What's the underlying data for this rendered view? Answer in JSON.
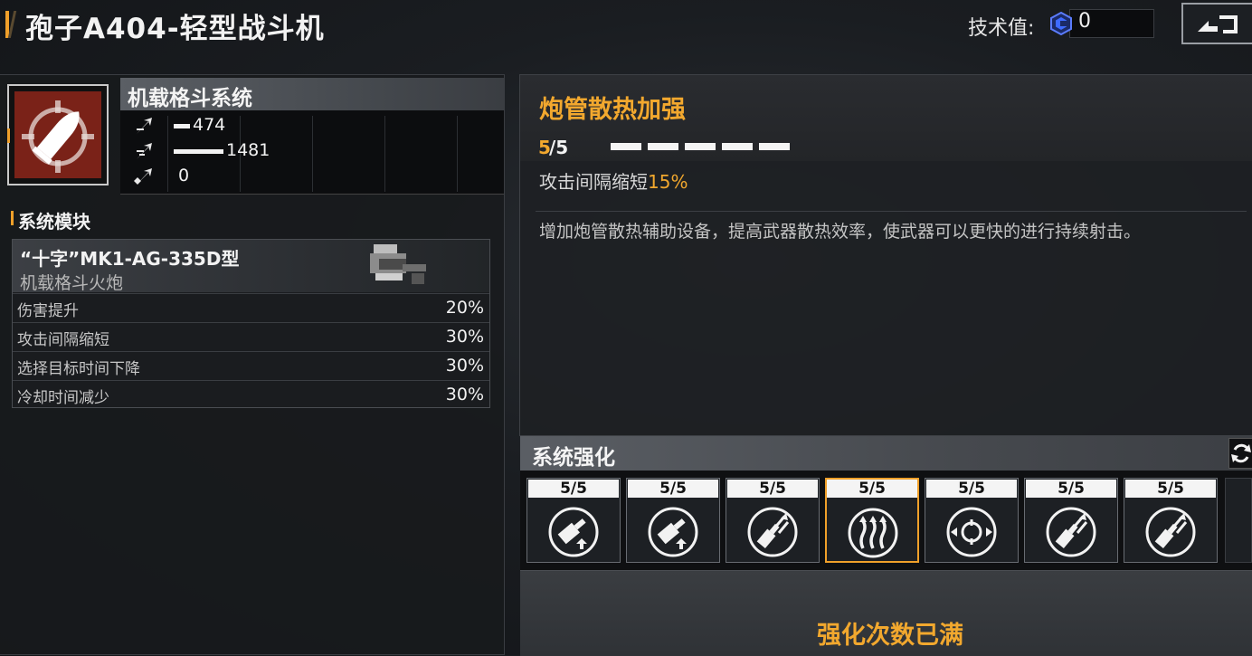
{
  "header": {
    "title": "孢子A404-轻型战斗机",
    "tech_label": "技术值:",
    "tech_value": "0",
    "tech_icon": "tech-point-icon",
    "back_icon": "back-arrow-icon"
  },
  "system": {
    "name": "机载格斗系统",
    "icon": "bullet-crosshair-icon",
    "stats": [
      {
        "icon": "attack-arrow-icon",
        "value": "474",
        "fraction": 0.32
      },
      {
        "icon": "speed-arrow-icon",
        "value": "1481",
        "fraction": 1.0
      },
      {
        "icon": "range-arrow-icon",
        "value": "0",
        "fraction": 0.0
      }
    ]
  },
  "modules": {
    "title": "系统模块",
    "card": {
      "name": "“十字”MK1-AG-335D型",
      "type": "机载格斗火炮",
      "rows": [
        {
          "label": "伤害提升",
          "value": "20%"
        },
        {
          "label": "攻击间隔缩短",
          "value": "30%"
        },
        {
          "label": "选择目标时间下降",
          "value": "30%"
        },
        {
          "label": "冷却时间减少",
          "value": "30%"
        }
      ]
    }
  },
  "upgrade": {
    "title": "炮管散热加强",
    "level_current": "5",
    "level_max": "/5",
    "pips_filled": 5,
    "pips_total": 5,
    "effect_label": "攻击间隔缩短",
    "effect_value": "15%",
    "description": "增加炮管散热辅助设备，提高武器散热效率，使武器可以更快的进行持续射击。"
  },
  "enhance": {
    "title": "系统强化",
    "refresh_icon": "refresh-icon",
    "slots": [
      {
        "level": "5/5",
        "icon": "cannon-up-icon",
        "selected": false
      },
      {
        "level": "5/5",
        "icon": "cannon-up-icon",
        "selected": false
      },
      {
        "level": "5/5",
        "icon": "cannon-arrows-icon",
        "selected": false
      },
      {
        "level": "5/5",
        "icon": "heat-waves-icon",
        "selected": true
      },
      {
        "level": "5/5",
        "icon": "target-crosshair-icon",
        "selected": false
      },
      {
        "level": "5/5",
        "icon": "cannon-arrows-icon",
        "selected": false
      },
      {
        "level": "5/5",
        "icon": "cannon-arrows-icon",
        "selected": false
      }
    ],
    "status": "强化次数已满"
  },
  "colors": {
    "accent": "#f2a82e",
    "icon_bg": "#7a2218"
  }
}
